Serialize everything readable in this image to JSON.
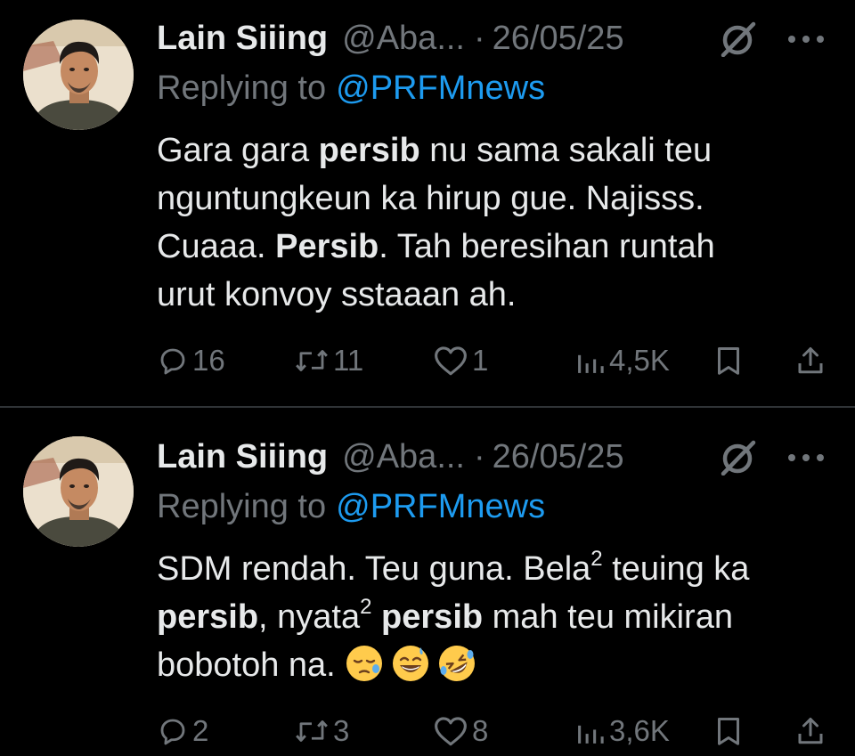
{
  "tweets": [
    {
      "author": "Lain Siiing",
      "handle": "@Aba...",
      "separator": "·",
      "date": "26/05/25",
      "replying_label": "Replying to",
      "replying_to": "@PRFMnews",
      "lines": [
        [
          {
            "t": "Gara gara "
          },
          {
            "t": "persib",
            "b": true
          },
          {
            "t": " nu sama sakali teu"
          }
        ],
        [
          {
            "t": "nguntungkeun ka hirup gue. Najisss."
          }
        ],
        [
          {
            "t": "Cuaaa. "
          },
          {
            "t": "Persib",
            "b": true
          },
          {
            "t": ". Tah beresihan runtah"
          }
        ],
        [
          {
            "t": "urut konvoy sstaaan ah."
          }
        ]
      ],
      "emojis": [],
      "stats": {
        "replies": "16",
        "reposts": "11",
        "likes": "1",
        "views": "4,5K"
      }
    },
    {
      "author": "Lain Siiing",
      "handle": "@Aba...",
      "separator": "·",
      "date": "26/05/25",
      "replying_label": "Replying to",
      "replying_to": "@PRFMnews",
      "lines": [
        [
          {
            "t": "SDM rendah. Teu guna. Bela"
          },
          {
            "t": "2",
            "sup": true
          },
          {
            "t": " teuing ka"
          }
        ],
        [
          {
            "t": "persib",
            "b": true
          },
          {
            "t": ", nyata"
          },
          {
            "t": "2",
            "sup": true
          },
          {
            "t": " "
          },
          {
            "t": "persib",
            "b": true
          },
          {
            "t": " mah teu mikiran"
          }
        ],
        [
          {
            "t": "bobotoh na. "
          }
        ]
      ],
      "emojis": [
        "sleepy-face",
        "grinning-face-with-sweat",
        "rolling-on-floor-laughing"
      ],
      "stats": {
        "replies": "2",
        "reposts": "3",
        "likes": "8",
        "views": "3,6K"
      }
    }
  ],
  "icons": [
    "grok-icon",
    "more-icon",
    "reply-icon",
    "repost-icon",
    "like-icon",
    "views-icon",
    "bookmark-icon",
    "share-icon"
  ],
  "colors": {
    "background": "#000000",
    "text": "#e7e9ea",
    "muted": "#71767b",
    "link": "#1d9bf0",
    "divider": "#2f3336"
  }
}
